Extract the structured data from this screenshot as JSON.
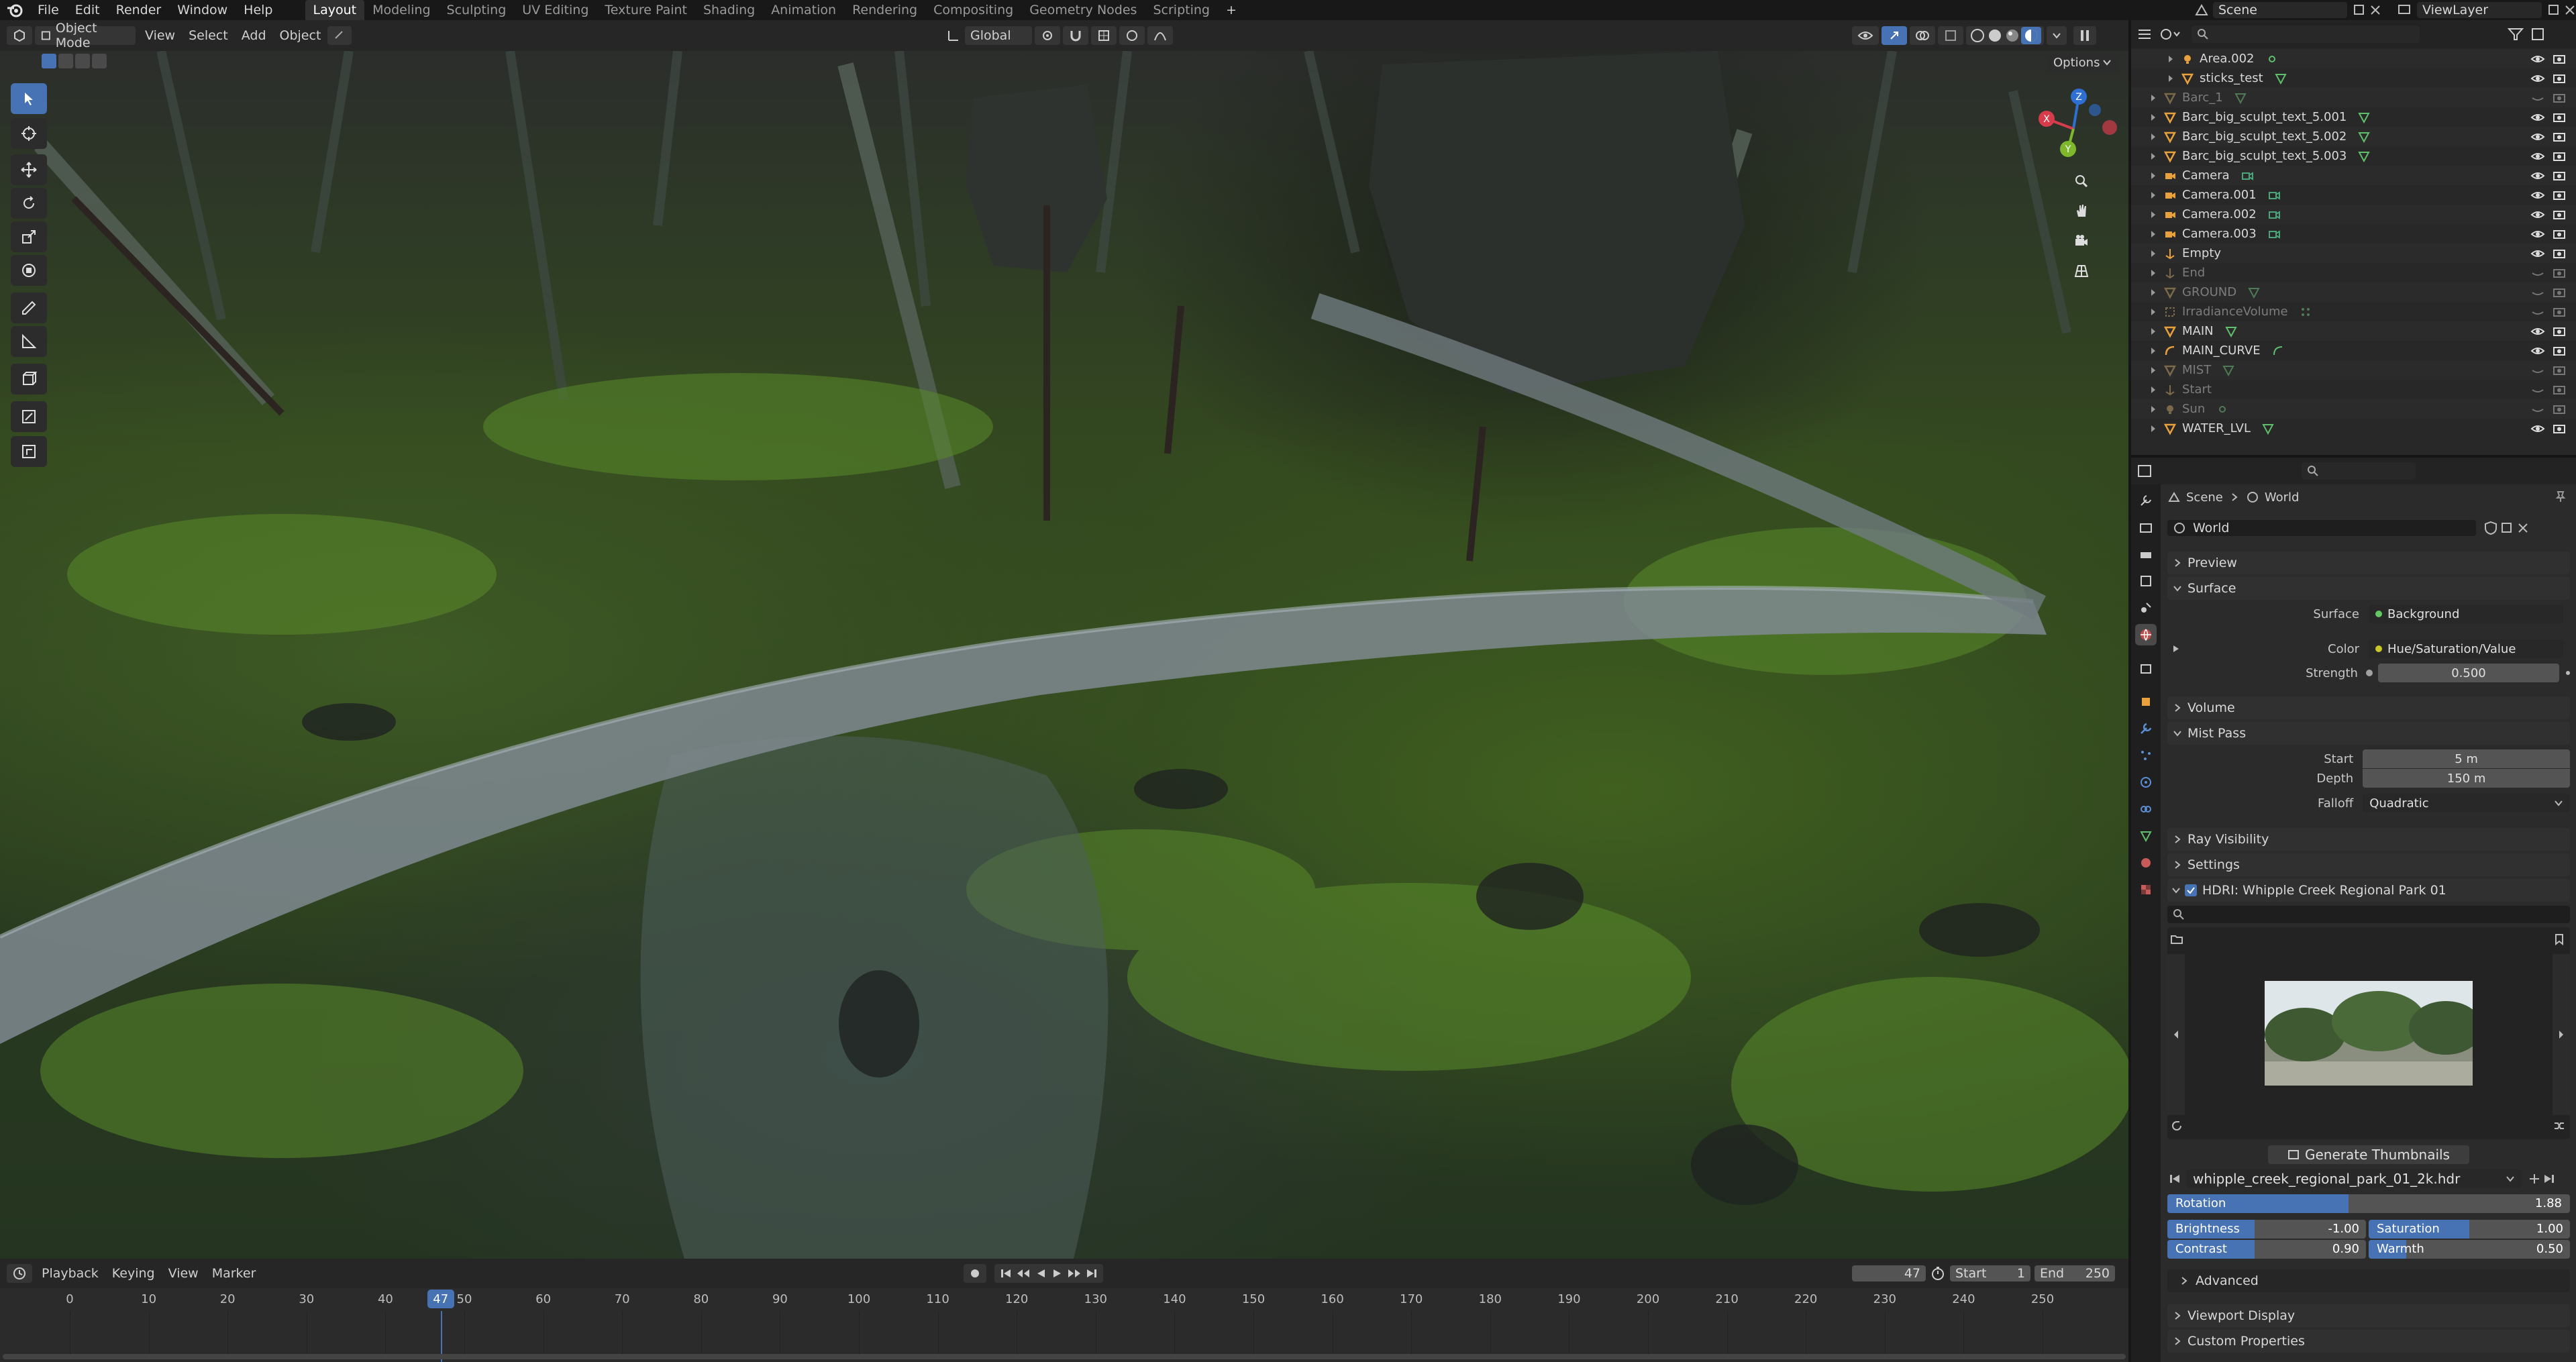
{
  "topbar": {
    "menus": [
      "File",
      "Edit",
      "Render",
      "Window",
      "Help"
    ],
    "workspaces": [
      "Layout",
      "Modeling",
      "Sculpting",
      "UV Editing",
      "Texture Paint",
      "Shading",
      "Animation",
      "Rendering",
      "Compositing",
      "Geometry Nodes",
      "Scripting"
    ],
    "active_workspace": "Layout",
    "scene": "Scene",
    "view_layer": "ViewLayer"
  },
  "viewport_header": {
    "mode": "Object Mode",
    "menus": [
      "View",
      "Select",
      "Add",
      "Object"
    ],
    "transform_orientation": "Global",
    "options": "Options"
  },
  "outliner": {
    "items": [
      {
        "name": "Area.002",
        "dim": false,
        "indent": 2
      },
      {
        "name": "sticks_test",
        "dim": false,
        "indent": 2
      },
      {
        "name": "Barc_1",
        "dim": true,
        "indent": 1
      },
      {
        "name": "Barc_big_sculpt_text_5.001",
        "dim": false,
        "indent": 1
      },
      {
        "name": "Barc_big_sculpt_text_5.002",
        "dim": false,
        "indent": 1
      },
      {
        "name": "Barc_big_sculpt_text_5.003",
        "dim": false,
        "indent": 1
      },
      {
        "name": "Camera",
        "dim": false,
        "indent": 1
      },
      {
        "name": "Camera.001",
        "dim": false,
        "indent": 1
      },
      {
        "name": "Camera.002",
        "dim": false,
        "indent": 1
      },
      {
        "name": "Camera.003",
        "dim": false,
        "indent": 1
      },
      {
        "name": "Empty",
        "dim": false,
        "indent": 1
      },
      {
        "name": "End",
        "dim": true,
        "indent": 1
      },
      {
        "name": "GROUND",
        "dim": true,
        "indent": 1
      },
      {
        "name": "IrradianceVolume",
        "dim": true,
        "indent": 1
      },
      {
        "name": "MAIN",
        "dim": false,
        "indent": 1
      },
      {
        "name": "MAIN_CURVE",
        "dim": false,
        "indent": 1
      },
      {
        "name": "MIST",
        "dim": true,
        "indent": 1
      },
      {
        "name": "Start",
        "dim": true,
        "indent": 1
      },
      {
        "name": "Sun",
        "dim": true,
        "indent": 1
      },
      {
        "name": "WATER_LVL",
        "dim": false,
        "indent": 1
      }
    ]
  },
  "properties": {
    "breadcrumb": [
      "Scene",
      "World"
    ],
    "world_name": "World",
    "panels": {
      "preview": "Preview",
      "surface": "Surface",
      "volume": "Volume",
      "mist_pass": "Mist Pass",
      "ray_visibility": "Ray Visibility",
      "settings": "Settings",
      "hdri": "HDRI: Whipple Creek Regional Park 01",
      "advanced": "Advanced",
      "viewport_display": "Viewport Display",
      "custom_properties": "Custom Properties"
    },
    "surface": {
      "label": "Surface",
      "value": "Background"
    },
    "color": {
      "label": "Color",
      "value": "Hue/Saturation/Value"
    },
    "strength": {
      "label": "Strength",
      "value": "0.500"
    },
    "mist": {
      "start_label": "Start",
      "start": "5 m",
      "depth_label": "Depth",
      "depth": "150 m",
      "falloff_label": "Falloff",
      "falloff": "Quadratic"
    },
    "hdri": {
      "generate": "Generate Thumbnails",
      "file": "whipple_creek_regional_park_01_2k.hdr",
      "rotation_label": "Rotation",
      "rotation": "1.88",
      "rotation_fill": 0.45,
      "brightness_label": "Brightness",
      "brightness": "-1.00",
      "saturation_label": "Saturation",
      "saturation": "1.00",
      "contrast_label": "Contrast",
      "contrast": "0.90",
      "warmth_label": "Warmth",
      "warmth": "0.50"
    }
  },
  "timeline": {
    "menus": [
      "Playback",
      "Keying",
      "View",
      "Marker"
    ],
    "current_frame": "47",
    "start_label": "Start",
    "start": "1",
    "end_label": "End",
    "end": "250",
    "ticks": [
      0,
      10,
      20,
      30,
      40,
      50,
      60,
      70,
      80,
      90,
      100,
      110,
      120,
      130,
      140,
      150,
      160,
      170,
      180,
      190,
      200,
      210,
      220,
      230,
      240,
      250
    ],
    "playhead": 47
  },
  "colors": {
    "accent": "#4772b3",
    "object_orange": "#e8a13c",
    "data_green": "#5fbf6a",
    "camera_green": "#4aa67a"
  }
}
